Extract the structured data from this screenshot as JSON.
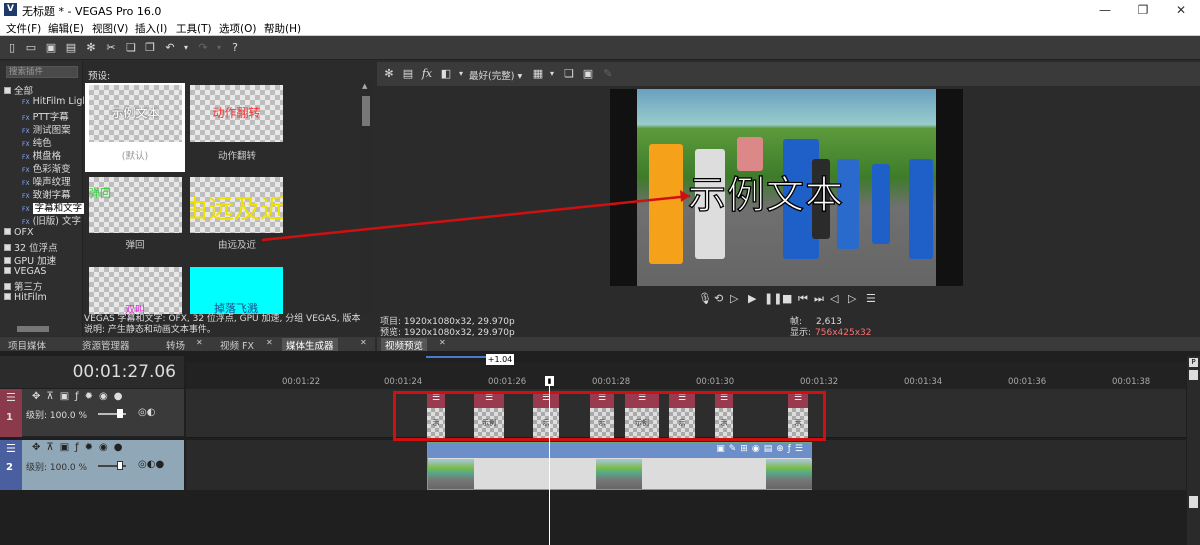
{
  "titlebar": {
    "title": "无标题 * - VEGAS Pro 16.0",
    "logo": "V"
  },
  "menu": [
    "文件(F)",
    "编辑(E)",
    "视图(V)",
    "插入(I)",
    "工具(T)",
    "选项(O)",
    "帮助(H)"
  ],
  "plugins": {
    "search_placeholder": "搜索插件",
    "tree": [
      {
        "label": "全部",
        "type": "folder"
      },
      {
        "label": "HitFilm Ligl",
        "type": "fx"
      },
      {
        "label": "PTT字幕",
        "type": "fx"
      },
      {
        "label": "测试图案",
        "type": "fx"
      },
      {
        "label": "纯色",
        "type": "fx"
      },
      {
        "label": "棋盘格",
        "type": "fx"
      },
      {
        "label": "色彩渐变",
        "type": "fx"
      },
      {
        "label": "噪声纹理",
        "type": "fx"
      },
      {
        "label": "致谢字幕",
        "type": "fx"
      },
      {
        "label": "字幕和文字",
        "type": "fx",
        "selected": true
      },
      {
        "label": "(旧版) 文字",
        "type": "fx"
      },
      {
        "label": "OFX",
        "type": "folder"
      },
      {
        "label": "32 位浮点",
        "type": "folder"
      },
      {
        "label": "GPU 加速",
        "type": "folder"
      },
      {
        "label": "VEGAS",
        "type": "folder"
      },
      {
        "label": "第三方",
        "type": "folder"
      },
      {
        "label": "HitFilm",
        "type": "folder"
      }
    ]
  },
  "presets": {
    "heading": "预设:",
    "items": [
      {
        "thumb_text": "示例文本",
        "label": "(默认)",
        "thumb_color": "#ffffff"
      },
      {
        "thumb_text": "动作翻转",
        "label": "动作翻转",
        "thumb_color": "#ff3333"
      },
      {
        "thumb_text": "弹回",
        "label": "弹回",
        "thumb_color": "#33cc33"
      },
      {
        "thumb_text": "由远及近",
        "label": "由远及近",
        "thumb_color": "#f0e000"
      },
      {
        "thumb_text": "双叫",
        "label": "",
        "thumb_color": "#dd33dd"
      },
      {
        "thumb_text": "掉落飞溅",
        "label": "",
        "thumb_color": "#00ffff"
      }
    ],
    "description_line1": "VEGAS 字幕和文字: OFX, 32 位浮点, GPU 加速, 分组 VEGAS, 版本",
    "description_line2": "说明: 产生静态和动画文本事件。"
  },
  "left_tabs": [
    "项目媒体",
    "资源管理器",
    "转场",
    "视频 FX",
    "媒体生成器"
  ],
  "preview": {
    "quality": "最好(完整)",
    "overlay_text": "示例文本",
    "project_line": "项目: 1920x1080x32, 29.970p",
    "preview_line": "预览: 1920x1080x32, 29.970p",
    "frame_label": "帧:",
    "frame_value": "2,613",
    "display_label": "显示:",
    "display_value": "756x425x32",
    "tab": "视频预览"
  },
  "timeline": {
    "timecode": "00:01:27.06",
    "rate": "+1.04",
    "ruler": [
      "00:01:22",
      "00:01:24",
      "00:01:26",
      "00:01:28",
      "00:01:30",
      "00:01:32",
      "00:01:34",
      "00:01:36",
      "00:01:38"
    ],
    "track1": {
      "number": "1",
      "level": "级别: 100.0 %"
    },
    "track2": {
      "number": "2",
      "level": "级别: 100.0 %"
    },
    "accent": "#d01010"
  }
}
